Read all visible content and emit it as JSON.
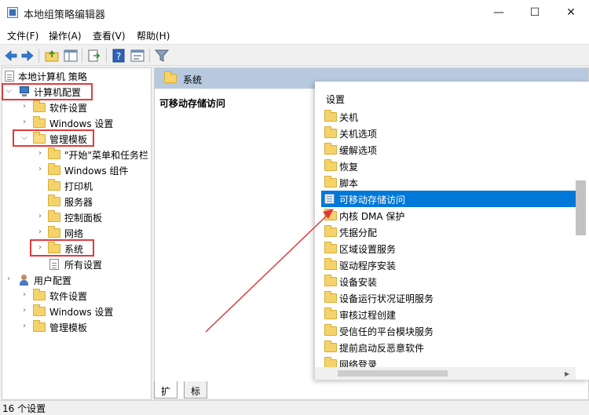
{
  "window": {
    "title": "本地组策略编辑器",
    "minimize_glyph": "—",
    "maximize_glyph": "☐",
    "close_glyph": "✕"
  },
  "menu": {
    "file": "文件(F)",
    "action": "操作(A)",
    "view": "查看(V)",
    "help": "帮助(H)"
  },
  "toolbar_icons": [
    "back-icon",
    "forward-icon",
    "up-folder-icon",
    "show-hide-tree-icon",
    "export-list-icon",
    "help-icon",
    "properties-icon",
    "filter-icon"
  ],
  "tree": {
    "root": "本地计算机 策略",
    "computer_config": "计算机配置",
    "software_settings": "软件设置",
    "windows_settings": "Windows 设置",
    "admin_templates": "管理模板",
    "start_menu": "\"开始\"菜单和任务栏",
    "windows_components": "Windows 组件",
    "printers": "打印机",
    "servers": "服务器",
    "control_panel": "控制面板",
    "network": "网络",
    "system": "系统",
    "all_settings": "所有设置",
    "user_config": "用户配置",
    "user_software_settings": "软件设置",
    "user_windows_settings": "Windows 设置",
    "user_admin_templates": "管理模板"
  },
  "right": {
    "header_title": "系统",
    "description_title": "可移动存储访问"
  },
  "popup": {
    "header": "设置",
    "items": [
      "关机",
      "关机选项",
      "缓解选项",
      "恢复",
      "脚本",
      "可移动存储访问",
      "内核 DMA 保护",
      "凭据分配",
      "区域设置服务",
      "驱动程序安装",
      "设备安装",
      "设备运行状况证明服务",
      "审核过程创建",
      "受信任的平台模块服务",
      "提前启动反恶意软件",
      "网络登录"
    ],
    "selected_item": "可移动存储访问"
  },
  "tabs": {
    "extended": "扩展",
    "standard": "标准"
  },
  "status": {
    "text": "16 个设置"
  },
  "colors": {
    "highlight_box": "#e23a3a",
    "selection": "#0078d7",
    "header_band": "#b6c9df",
    "folder": "#f5d36c"
  }
}
